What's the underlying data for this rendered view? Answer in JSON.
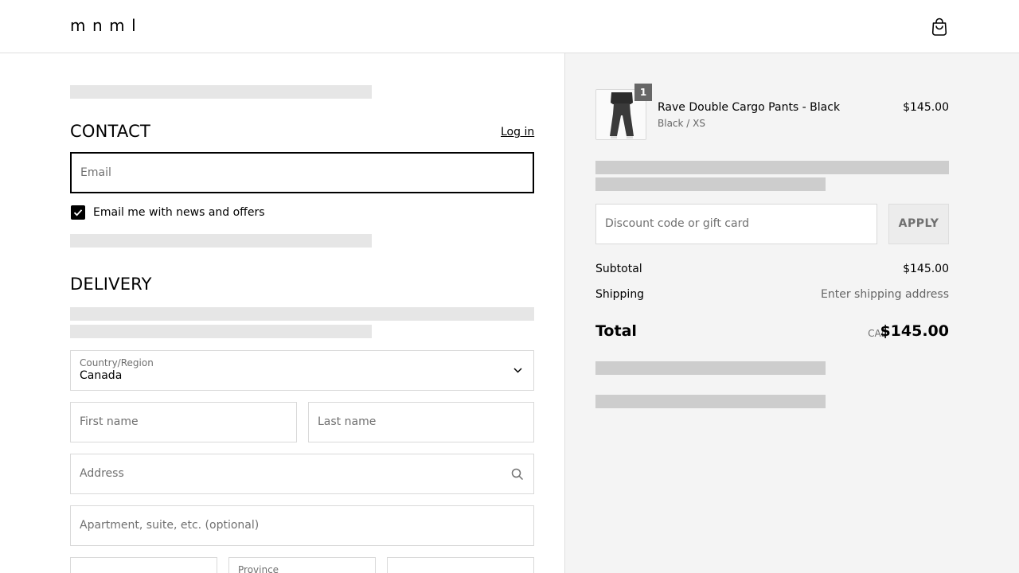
{
  "brand": {
    "logo": "mnml"
  },
  "contact": {
    "title": "CONTACT",
    "login_link": "Log in",
    "email_placeholder": "Email",
    "newsletter_label": "Email me with news and offers",
    "newsletter_checked": true
  },
  "delivery": {
    "title": "DELIVERY",
    "country_label": "Country/Region",
    "country_value": "Canada",
    "first_name_placeholder": "First name",
    "last_name_placeholder": "Last name",
    "address_placeholder": "Address",
    "apartment_placeholder": "Apartment, suite, etc. (optional)",
    "province_label": "Province"
  },
  "summary": {
    "item": {
      "name": "Rave Double Cargo Pants - Black",
      "variant": "Black / XS",
      "price": "$145.00",
      "quantity": "1"
    },
    "discount_placeholder": "Discount code or gift card",
    "apply_label": "APPLY",
    "subtotal_label": "Subtotal",
    "subtotal_value": "$145.00",
    "shipping_label": "Shipping",
    "shipping_value": "Enter shipping address",
    "total_label": "Total",
    "total_currency": "CAD",
    "total_value": "$145.00"
  },
  "icons": {
    "cart": "shopping-bag-icon",
    "checkbox": "checkmark-icon",
    "select": "chevron-down-icon",
    "search": "search-icon"
  }
}
